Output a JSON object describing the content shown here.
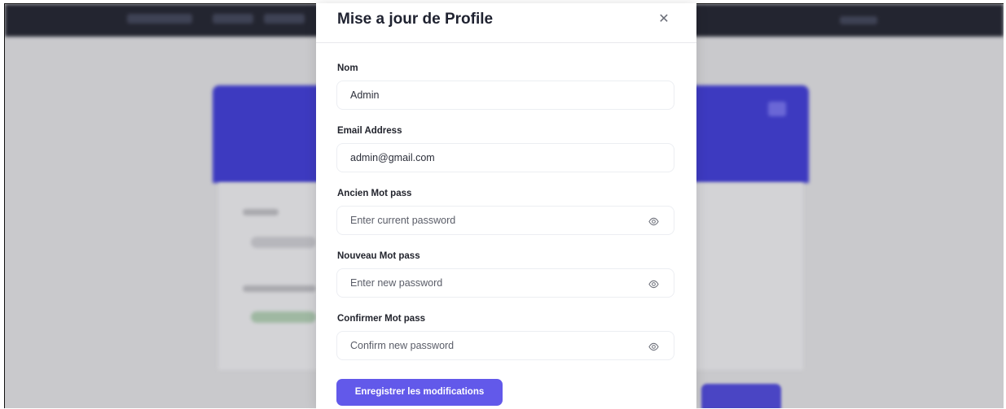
{
  "modal": {
    "title": "Mise a jour de Profile",
    "close_symbol": "✕",
    "fields": [
      {
        "label": "Nom",
        "value": "Admin",
        "placeholder": "",
        "type": "text"
      },
      {
        "label": "Email Address",
        "value": "admin@gmail.com",
        "placeholder": "",
        "type": "email"
      },
      {
        "label": "Ancien Mot pass",
        "value": "",
        "placeholder": "Enter current password",
        "type": "password",
        "icon": "eye-icon"
      },
      {
        "label": "Nouveau Mot pass",
        "value": "",
        "placeholder": "Enter new password",
        "type": "password",
        "icon": "eye-icon"
      },
      {
        "label": "Confirmer Mot pass",
        "value": "",
        "placeholder": "Confirm new password",
        "type": "password",
        "icon": "eye-icon"
      }
    ],
    "submit_label": "Enregistrer les modifications"
  },
  "colors": {
    "accent": "#6259ea",
    "hero": "#3d3ac0",
    "navbar": "#232530",
    "overlay": "#c9c9cc"
  }
}
